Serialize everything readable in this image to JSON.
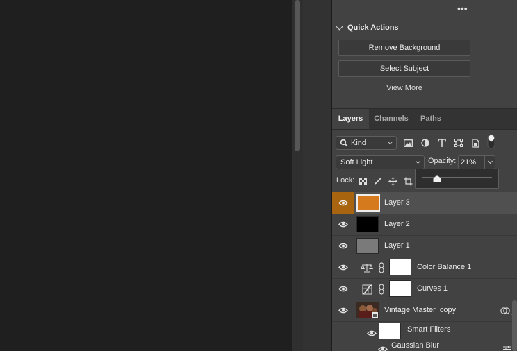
{
  "quick_actions": {
    "more_label": "•••",
    "title": "Quick Actions",
    "remove_background": "Remove Background",
    "select_subject": "Select Subject",
    "view_more": "View More"
  },
  "tabs": [
    {
      "label": "Layers",
      "active": true
    },
    {
      "label": "Channels",
      "active": false
    },
    {
      "label": "Paths",
      "active": false
    }
  ],
  "filter": {
    "kind_label": "Kind",
    "icons": [
      "image-filter-icon",
      "adjustment-filter-icon",
      "type-filter-icon",
      "shape-filter-icon",
      "smart-object-filter-icon",
      "filter-toggle-icon"
    ]
  },
  "blend": {
    "mode": "Soft Light",
    "opacity_label": "Opacity:",
    "opacity_value": "21%",
    "opacity_level": 0.21
  },
  "lock": {
    "label": "Lock:",
    "icons": [
      "lock-transparent-icon",
      "lock-image-icon",
      "lock-position-icon",
      "lock-artboard-icon"
    ]
  },
  "layers": [
    {
      "name": "Layer 3",
      "selected": true,
      "thumb_color": "#d67a1e"
    },
    {
      "name": "Layer 2",
      "selected": false,
      "thumb_color": "#000000"
    },
    {
      "name": "Layer 1",
      "selected": false,
      "thumb_color": "#7a7a7a"
    },
    {
      "name": "Color Balance 1",
      "adjustment": "color-balance-icon"
    },
    {
      "name": "Curves 1",
      "adjustment": "curves-icon"
    },
    {
      "name": "Vintage Master  copy",
      "smart_object": true
    },
    {
      "name": "Smart Filters"
    },
    {
      "name": "Gaussian Blur"
    }
  ],
  "colors": {
    "selection_accent": "#a8640f",
    "panel_bg": "#424242",
    "canvas_bg": "#1f1f1f"
  }
}
